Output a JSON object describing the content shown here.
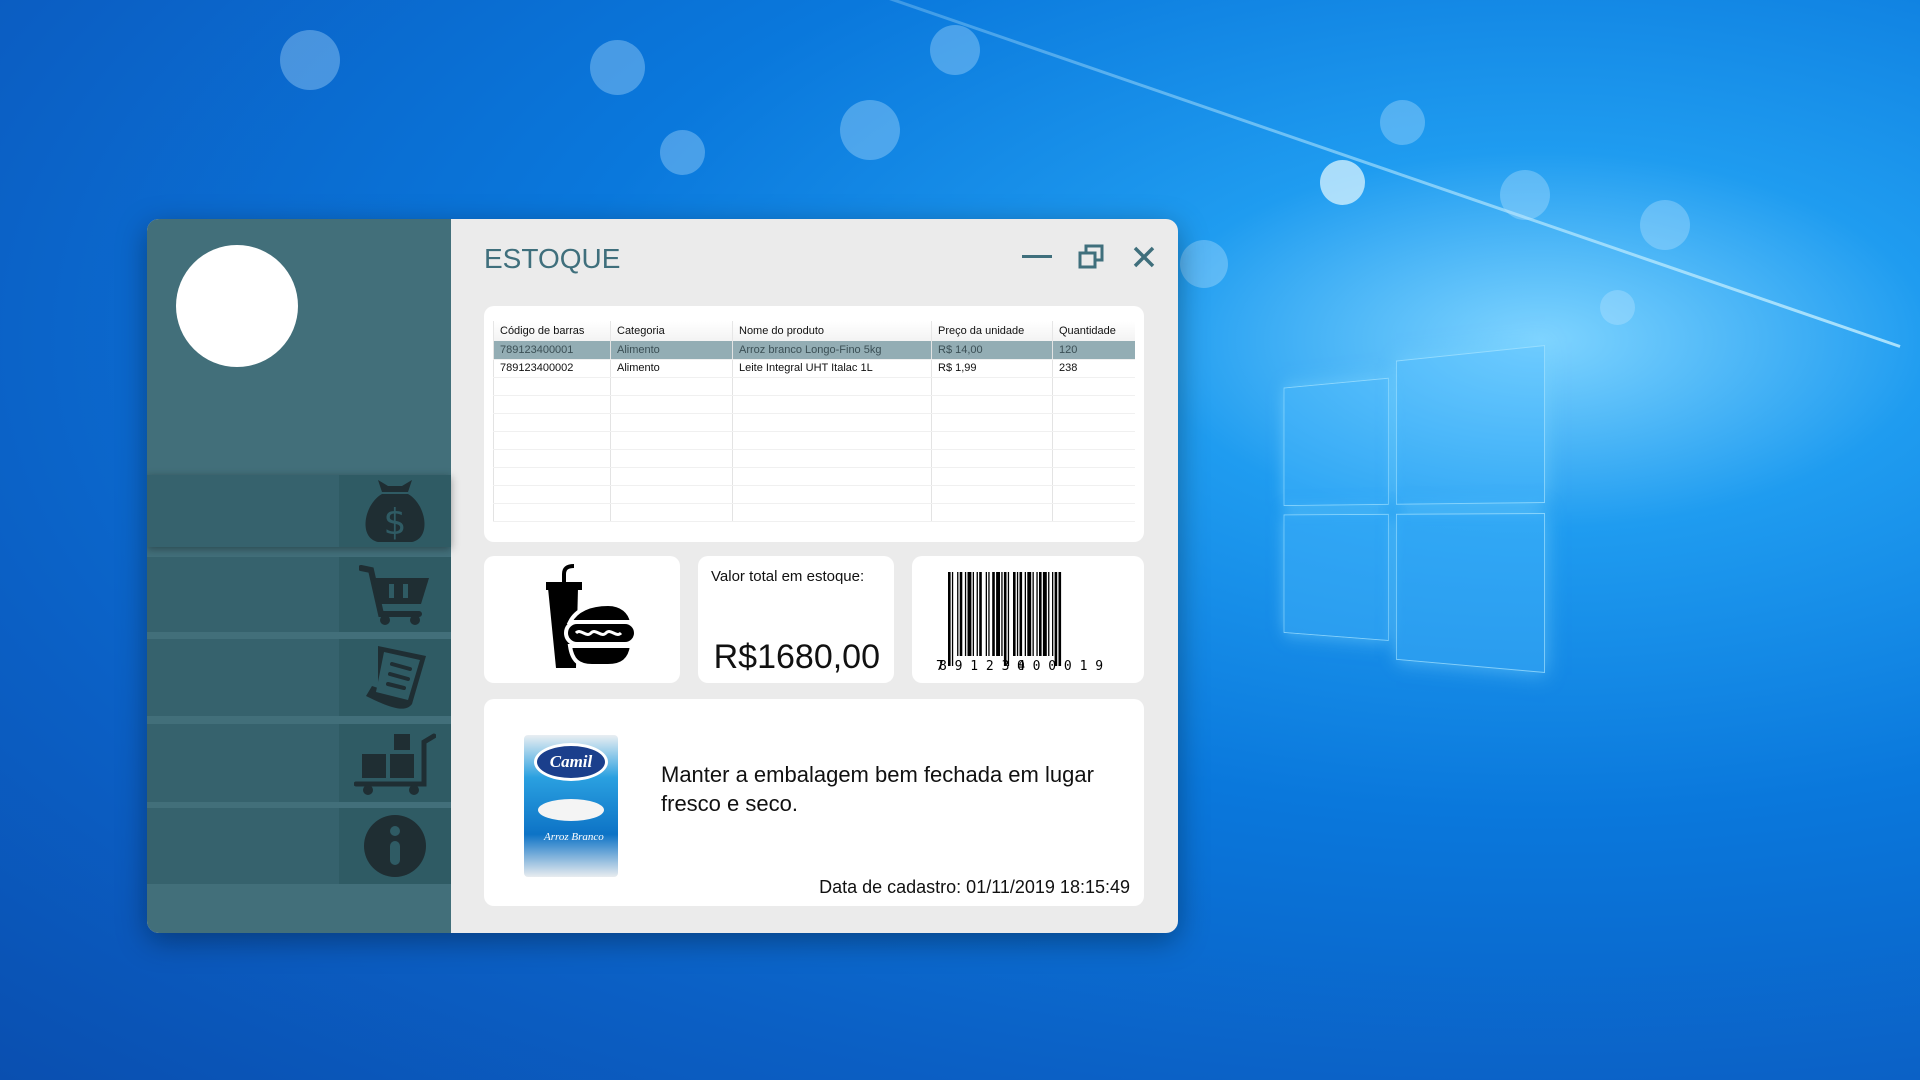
{
  "window": {
    "title": "ESTOQUE",
    "minimize_icon": "minimize-icon",
    "restore_icon": "restore-icon",
    "close_icon": "close-icon"
  },
  "sidebar": {
    "items": [
      {
        "name": "finance",
        "icon": "money-bag-icon"
      },
      {
        "name": "sales",
        "icon": "shopping-cart-icon"
      },
      {
        "name": "reports",
        "icon": "receipt-list-icon"
      },
      {
        "name": "stock",
        "icon": "boxes-cart-icon"
      },
      {
        "name": "about",
        "icon": "info-icon"
      }
    ]
  },
  "table": {
    "columns": [
      "Código de barras",
      "Categoria",
      "Nome do produto",
      "Preço da unidade",
      "Quantidade"
    ],
    "rows": [
      [
        "789123400001",
        "Alimento",
        "Arroz branco Longo-Fino 5kg",
        "R$ 14,00",
        "120"
      ],
      [
        "789123400002",
        "Alimento",
        "Leite Integral UHT Italac 1L",
        "R$ 1,99",
        "238"
      ]
    ]
  },
  "category_card": {
    "icon": "food-drink-icon"
  },
  "total_card": {
    "label": "Valor total em estoque:",
    "value": "R$1680,00"
  },
  "barcode": {
    "number": "7891234000019",
    "digits_left": "7",
    "digits_mid": "891234",
    "digits_right": "000019"
  },
  "product": {
    "image_brand": "Camil",
    "image_text": "Arroz Branco",
    "note": "Manter a embalagem bem fechada em lugar fresco e seco.",
    "date_label": "Data de cadastro: 01/11/2019 18:15:49"
  },
  "colors": {
    "sidebar": "#426f7a",
    "nav": "#36626d",
    "accent": "#3f6f7c",
    "selected_row": "#93adb4"
  }
}
